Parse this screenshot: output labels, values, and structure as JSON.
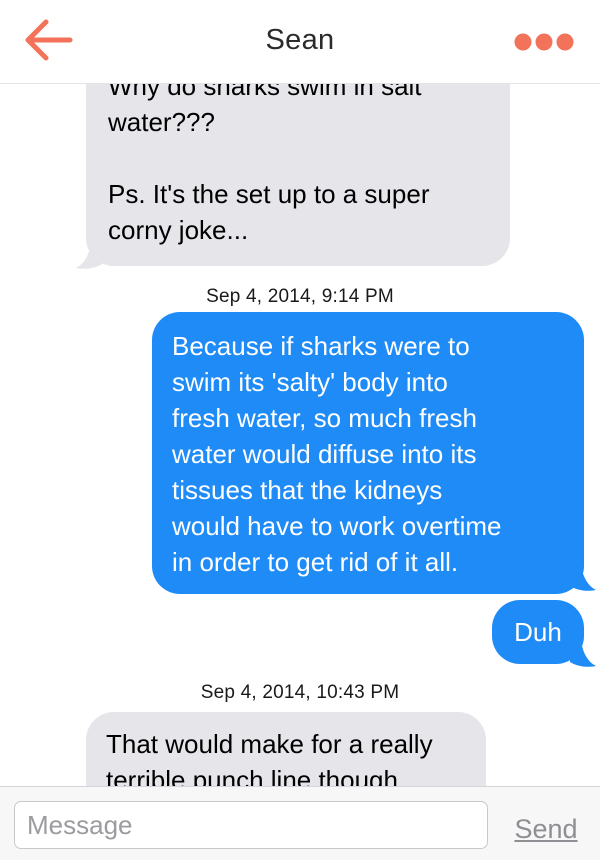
{
  "header": {
    "title": "Sean",
    "back_icon": "arrow-left-icon",
    "more_icon": "ellipsis-icon",
    "accent_color": "#f2735a"
  },
  "messages": [
    {
      "direction": "incoming",
      "text": "Why do sharks swim in salt\nwater???\n\nPs. It's the set up to a super\ncorny joke..."
    },
    {
      "type": "timestamp",
      "text": "Sep 4, 2014, 9:14 PM"
    },
    {
      "direction": "outgoing",
      "text": "Because if sharks were to\nswim its 'salty' body into\nfresh water, so much fresh\nwater would diffuse into its\ntissues that the kidneys\nwould have to work overtime\nin order to get rid of it all."
    },
    {
      "direction": "outgoing",
      "text": "Duh"
    },
    {
      "type": "timestamp",
      "text": "Sep 4, 2014, 10:43 PM"
    },
    {
      "direction": "incoming",
      "text": "That would make for a really\nterrible punch line though"
    }
  ],
  "colors": {
    "incoming_bubble": "#e5e5ea",
    "outgoing_bubble": "#1f8bf7"
  },
  "composer": {
    "placeholder": "Message",
    "send_label": "Send"
  }
}
